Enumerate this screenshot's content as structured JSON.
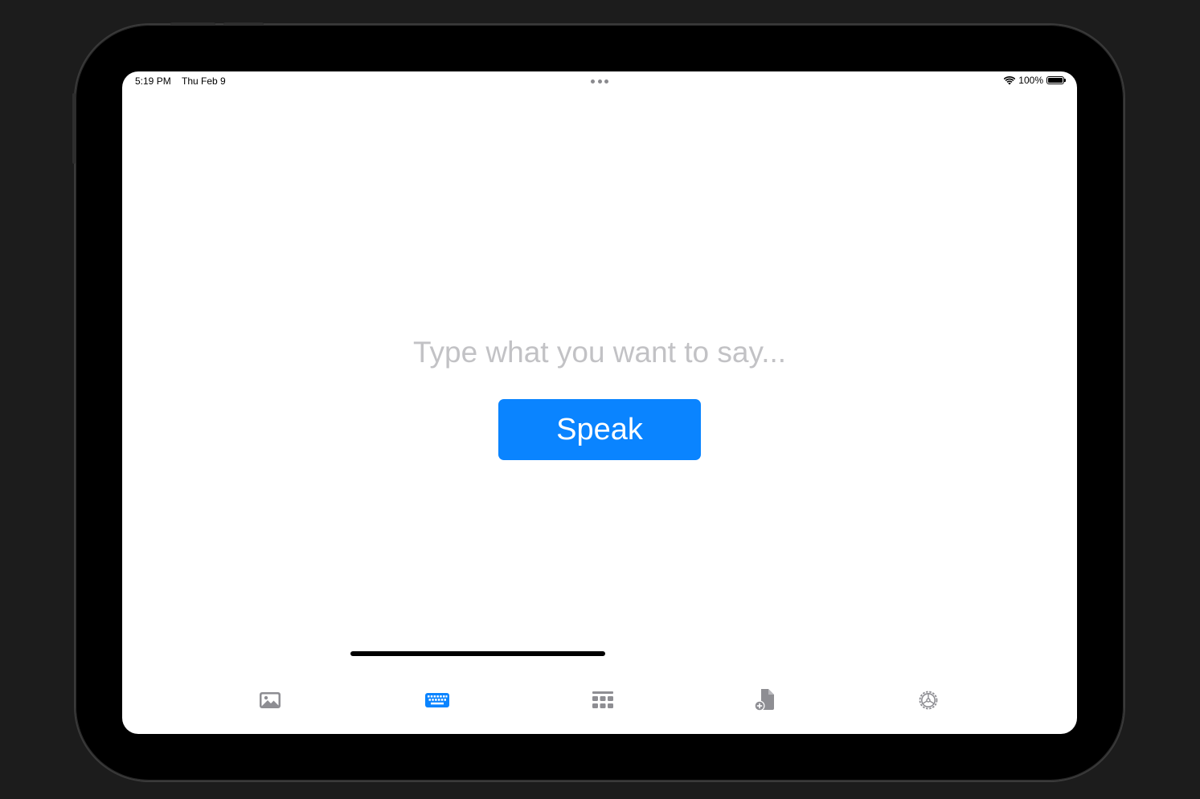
{
  "status_bar": {
    "time": "5:19 PM",
    "date": "Thu Feb 9",
    "battery_percent": "100%",
    "wifi_icon": "wifi-icon",
    "battery_icon": "battery-full-icon"
  },
  "composer": {
    "placeholder": "Type what you want to say...",
    "value": ""
  },
  "speak_button": {
    "label": "Speak",
    "color": "#0a84ff"
  },
  "tabs": [
    {
      "icon": "photo-icon",
      "active": false
    },
    {
      "icon": "keyboard-icon",
      "active": true
    },
    {
      "icon": "grid-icon",
      "active": false
    },
    {
      "icon": "add-document-icon",
      "active": false
    },
    {
      "icon": "settings-gear-icon",
      "active": false
    }
  ],
  "colors": {
    "accent": "#0a84ff",
    "inactive_icon": "#8e8e93",
    "placeholder": "#c2c2c5"
  }
}
